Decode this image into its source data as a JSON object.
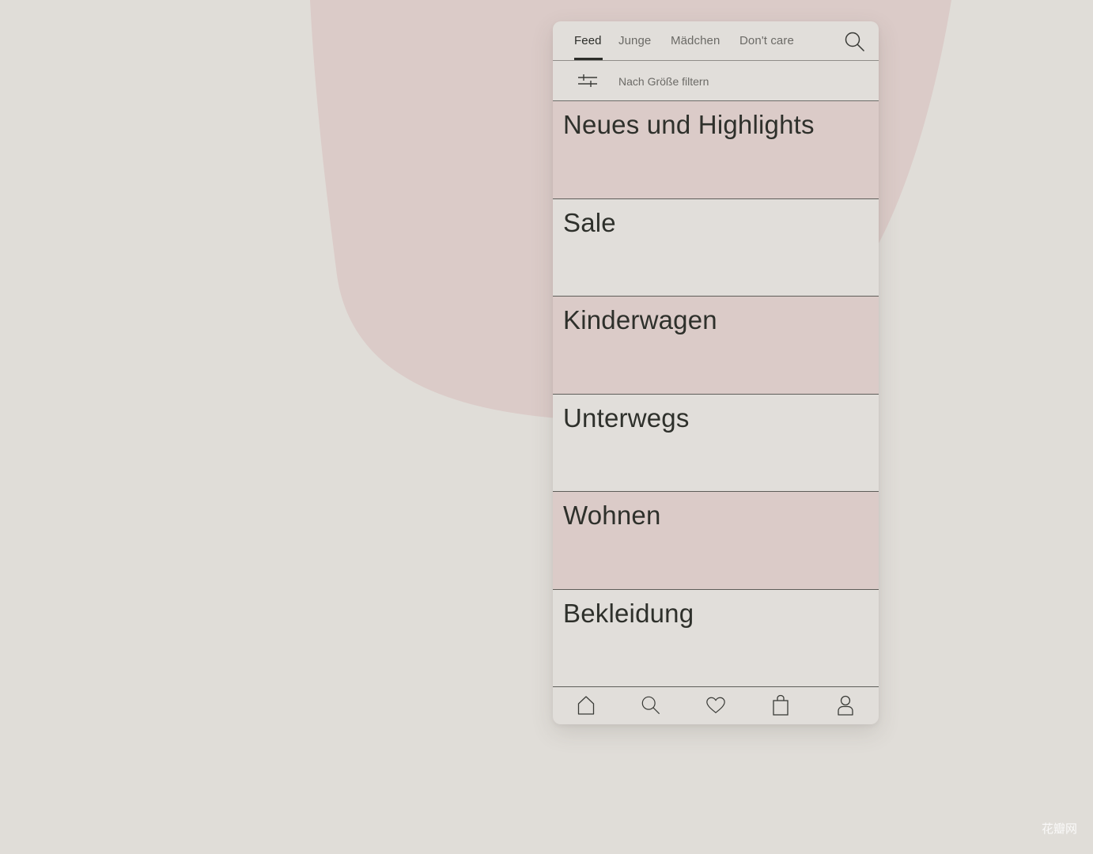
{
  "colors": {
    "background": "#e0ddd8",
    "blob": "#dbcbc8",
    "card_light": "#e1deda",
    "card_pink": "#dbcbc8",
    "text_dark": "#2e302b",
    "text_muted": "#6b6a66"
  },
  "tabs": [
    {
      "label": "Feed",
      "active": true
    },
    {
      "label": "Junge",
      "active": false
    },
    {
      "label": "Mädchen",
      "active": false
    },
    {
      "label": "Don't care",
      "active": false
    }
  ],
  "filter": {
    "icon": "sliders-icon",
    "label": "Nach Größe filtern"
  },
  "categories": [
    {
      "label": "Neues und Highlights",
      "tone": "pink"
    },
    {
      "label": "Sale",
      "tone": "light"
    },
    {
      "label": "Kinderwagen",
      "tone": "pink"
    },
    {
      "label": "Unterwegs",
      "tone": "light"
    },
    {
      "label": "Wohnen",
      "tone": "pink"
    },
    {
      "label": "Bekleidung",
      "tone": "light"
    }
  ],
  "bottom_nav": [
    {
      "icon": "home-icon"
    },
    {
      "icon": "search-icon"
    },
    {
      "icon": "heart-icon"
    },
    {
      "icon": "shopping-bag-icon"
    },
    {
      "icon": "profile-icon"
    }
  ],
  "watermark": "花瓣网"
}
